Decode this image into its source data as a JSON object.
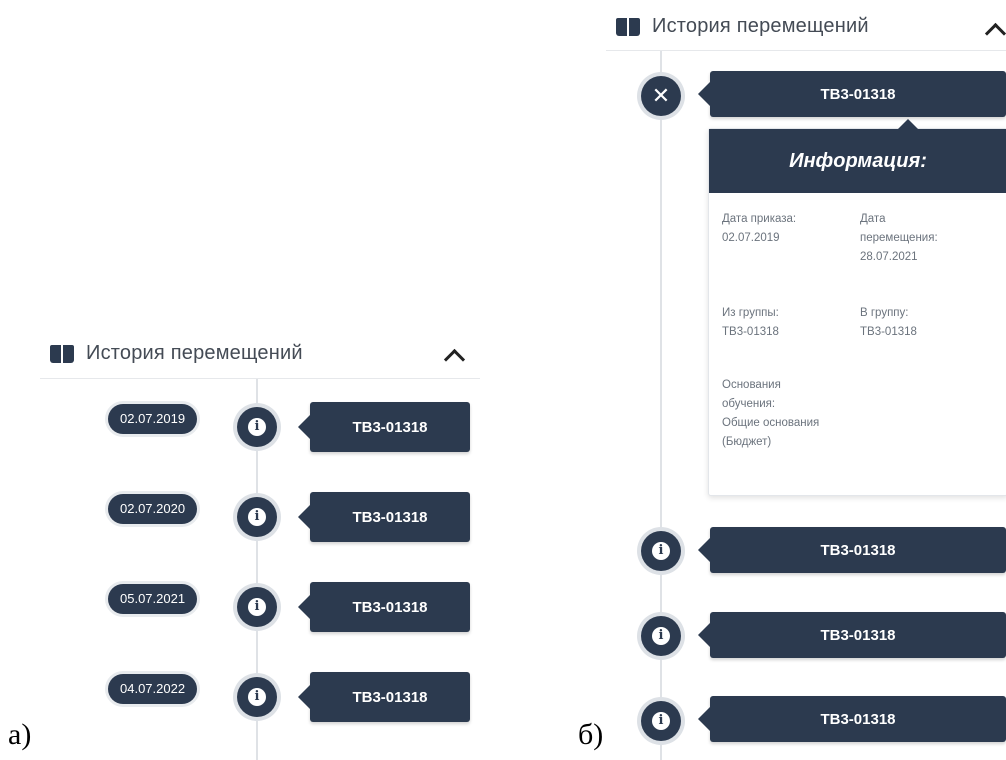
{
  "captions": {
    "a": "а)",
    "b": "б)"
  },
  "header": {
    "title": "История перемещений"
  },
  "panel_a": {
    "items": [
      {
        "date": "02.07.2019",
        "group": "ТВ3-01318"
      },
      {
        "date": "02.07.2020",
        "group": "ТВ3-01318"
      },
      {
        "date": "05.07.2021",
        "group": "ТВ3-01318"
      },
      {
        "date": "04.07.2022",
        "group": "ТВ3-01318"
      }
    ]
  },
  "panel_b": {
    "top_group": "ТВ3-01318",
    "card": {
      "title": "Информация:",
      "order_date_label": "Дата приказа:",
      "order_date": "02.07.2019",
      "move_date_label_1": "Дата",
      "move_date_label_2": "перемещения:",
      "move_date": "28.07.2021",
      "from_group_label": "Из группы:",
      "from_group": "ТВ3-01318",
      "to_group_label": "В группу:",
      "to_group": "ТВ3-01318",
      "basis_label_1": "Основания",
      "basis_label_2": "обучения:",
      "basis_value_1": "Общие основания",
      "basis_value_2": "(Бюджет)"
    },
    "items": [
      {
        "group": "ТВ3-01318"
      },
      {
        "group": "ТВ3-01318"
      },
      {
        "group": "ТВ3-01318"
      }
    ]
  },
  "colors": {
    "primary": "#2c3a4f",
    "line": "#dfe2e6"
  }
}
